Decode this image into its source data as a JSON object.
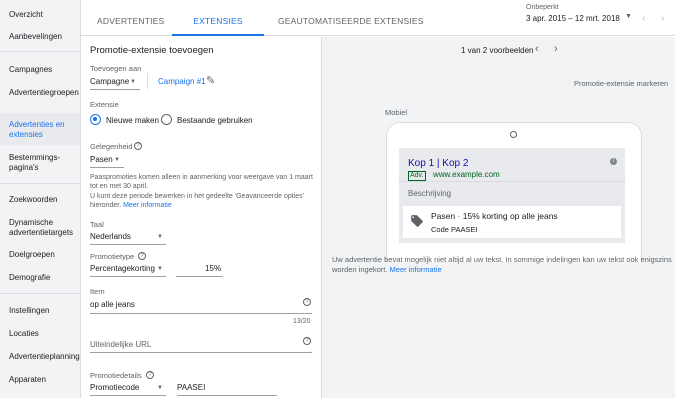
{
  "sidebar": {
    "items": [
      {
        "label": "Overzicht"
      },
      {
        "label": "Aanbevelingen"
      },
      {
        "label": "Campagnes"
      },
      {
        "label": "Advertentiegroepen"
      },
      {
        "label": "Advertenties en extensies"
      },
      {
        "label": "Bestemmings-pagina's"
      },
      {
        "label": "Zoekwoorden"
      },
      {
        "label": "Dynamische advertentietargets"
      },
      {
        "label": "Doelgroepen"
      },
      {
        "label": "Demografie"
      },
      {
        "label": "Instellingen"
      },
      {
        "label": "Locaties"
      },
      {
        "label": "Advertentieplanning"
      },
      {
        "label": "Apparaten"
      }
    ],
    "active_index": 4
  },
  "tabs": [
    {
      "label": "Advertenties"
    },
    {
      "label": "Extensies"
    },
    {
      "label": "Geautomatiseerde extensies"
    }
  ],
  "active_tab_index": 1,
  "date_range": {
    "label": "Onbeperkt",
    "value": "3 apr. 2015 – 12 mrt. 2018"
  },
  "form": {
    "title": "Promotie-extensie toevoegen",
    "add_to_label": "Toevoegen aan",
    "add_to_level": "Campagne",
    "campaign_link": "Campaign #1",
    "extension_label": "Extensie",
    "radio_new": "Nieuwe maken",
    "radio_existing": "Bestaande gebruiken",
    "occasion_label": "Gelegenheid",
    "occasion_value": "Pasen",
    "occasion_note_line1": "Paaspromoties komen alleen in aanmerking voor weergave van 1 maart",
    "occasion_note_line2": "tot en met 30 april.",
    "occasion_note_line3": "U kunt deze periode bewerken in het gedeelte 'Geavanceerde opties'",
    "occasion_note_line4": "hieronder.",
    "more_info": "Meer informatie",
    "language_label": "Taal",
    "language_value": "Nederlands",
    "promo_type_label": "Promotietype",
    "promo_type_value": "Percentagekorting",
    "percent_value": "15",
    "percent_unit": "%",
    "item_label": "Item",
    "item_value": "op alle jeans",
    "item_counter": "13/20",
    "final_url_label": "Uiteindelijke URL",
    "promo_details_label": "Promotiedetails",
    "promo_details_type": "Promotiecode",
    "promo_code_value": "PAASEI"
  },
  "preview": {
    "pager_text": "1 van 2 voorbeelden",
    "mark_label": "Promotie-extensie markeren",
    "device_label": "Mobiel",
    "ad_title": "Kop 1 | Kop 2",
    "ad_badge": "Adv.",
    "ad_url": "www.example.com",
    "ad_description": "Beschrijving",
    "promo_occasion": "Pasen",
    "promo_separator": "·",
    "promo_text": "15% korting op alle jeans",
    "promo_code": "Code PAASEI",
    "note_line1": "Uw advertentie bevat mogelijk niet altijd al uw tekst. In sommige indelingen kan uw tekst ook enigszins",
    "note_line2": "worden ingekort.",
    "note_link": "Meer informatie"
  },
  "colors": {
    "accent": "#1a73e8",
    "ad_title": "#1a0dab",
    "ad_url": "#006621"
  }
}
